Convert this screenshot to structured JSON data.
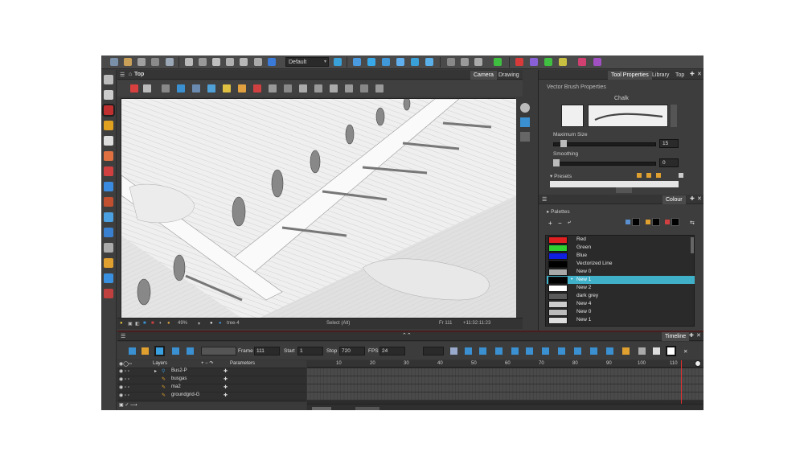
{
  "workspace": {
    "selected": "Default"
  },
  "view_panel": {
    "title": "Top",
    "tabs": [
      "Camera",
      "Drawing"
    ],
    "status": {
      "zoom": "49%",
      "tool": "Select (Alt)",
      "frame": "Fr 111",
      "timecode": "+11:32:11:23",
      "layer": "tree-4"
    }
  },
  "tool_properties": {
    "tabs": [
      "Tool Properties",
      "Library",
      "Top"
    ],
    "section": "Vector Brush Properties",
    "brush_name": "Chalk",
    "max_size_label": "Maximum Size",
    "max_size_value": "15",
    "smoothing_label": "Smoothing",
    "smoothing_value": "0",
    "presets_label": "Presets"
  },
  "colour": {
    "title": "Colour",
    "palettes_label": "Palettes",
    "swatches": [
      {
        "name": "Red",
        "color": "#e02020"
      },
      {
        "name": "Green",
        "color": "#30d030"
      },
      {
        "name": "Blue",
        "color": "#1020e0"
      },
      {
        "name": "Vectorized Line",
        "color": "#000000"
      },
      {
        "name": "New 0",
        "color": "#a8a8a8"
      },
      {
        "name": "New 1",
        "color": "#000000"
      },
      {
        "name": "New 2",
        "color": "#ffffff"
      },
      {
        "name": "dark grey",
        "color": "#5a5a5a"
      },
      {
        "name": "New 4",
        "color": "#cccccc"
      },
      {
        "name": "New 0",
        "color": "#bbbbbb"
      },
      {
        "name": "New 1",
        "color": "#dddddd"
      }
    ],
    "selected_index": 5
  },
  "timeline": {
    "title": "Timeline",
    "frame_label": "Frame",
    "frame_value": "111",
    "start_label": "Start",
    "start_value": "1",
    "stop_label": "Stop",
    "stop_value": "720",
    "fps_label": "FPS",
    "fps_value": "24",
    "layers_label": "Layers",
    "parameters_label": "Parameters",
    "layers": [
      "Bus2-P",
      "busgas",
      "ma2",
      "groundgrid-G"
    ],
    "ruler": [
      "10",
      "20",
      "30",
      "40",
      "50",
      "60",
      "70",
      "80",
      "90",
      "100",
      "110"
    ]
  }
}
